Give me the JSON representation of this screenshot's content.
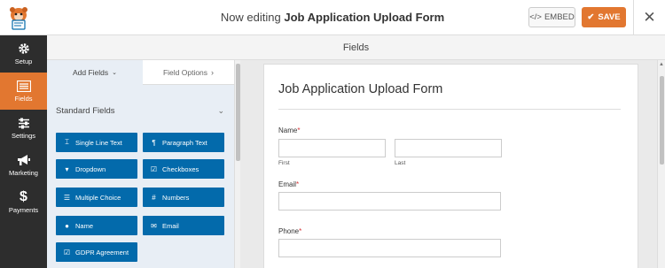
{
  "header": {
    "title_prefix": "Now editing",
    "title_form": "Job Application Upload Form",
    "embed_label": "EMBED",
    "save_label": "SAVE",
    "close_glyph": "✕"
  },
  "sidebar": {
    "items": [
      {
        "label": "Setup",
        "icon": "gear-icon"
      },
      {
        "label": "Fields",
        "icon": "fields-list-icon",
        "active": true
      },
      {
        "label": "Settings",
        "icon": "sliders-icon"
      },
      {
        "label": "Marketing",
        "icon": "megaphone-icon"
      },
      {
        "label": "Payments",
        "icon": "dollar-icon"
      }
    ]
  },
  "section_header": "Fields",
  "panel": {
    "tab_add": "Add Fields",
    "tab_options": "Field Options",
    "group_title": "Standard Fields",
    "fields": [
      {
        "label": "Single Line Text",
        "icon": "text-cursor-icon"
      },
      {
        "label": "Paragraph Text",
        "icon": "paragraph-icon"
      },
      {
        "label": "Dropdown",
        "icon": "dropdown-icon"
      },
      {
        "label": "Checkboxes",
        "icon": "checkbox-icon"
      },
      {
        "label": "Multiple Choice",
        "icon": "list-icon"
      },
      {
        "label": "Numbers",
        "icon": "hash-icon"
      },
      {
        "label": "Name",
        "icon": "user-icon"
      },
      {
        "label": "Email",
        "icon": "envelope-icon"
      },
      {
        "label": "GDPR Agreement",
        "icon": "checkbox-icon"
      }
    ]
  },
  "form": {
    "title": "Job Application Upload Form",
    "name_label": "Name",
    "first_label": "First",
    "last_label": "Last",
    "email_label": "Email",
    "phone_label": "Phone",
    "required_mark": "*"
  },
  "colors": {
    "accent": "#e27730",
    "field_button": "#036aab",
    "sidebar_bg": "#2d2d2d",
    "required": "#d63638"
  }
}
